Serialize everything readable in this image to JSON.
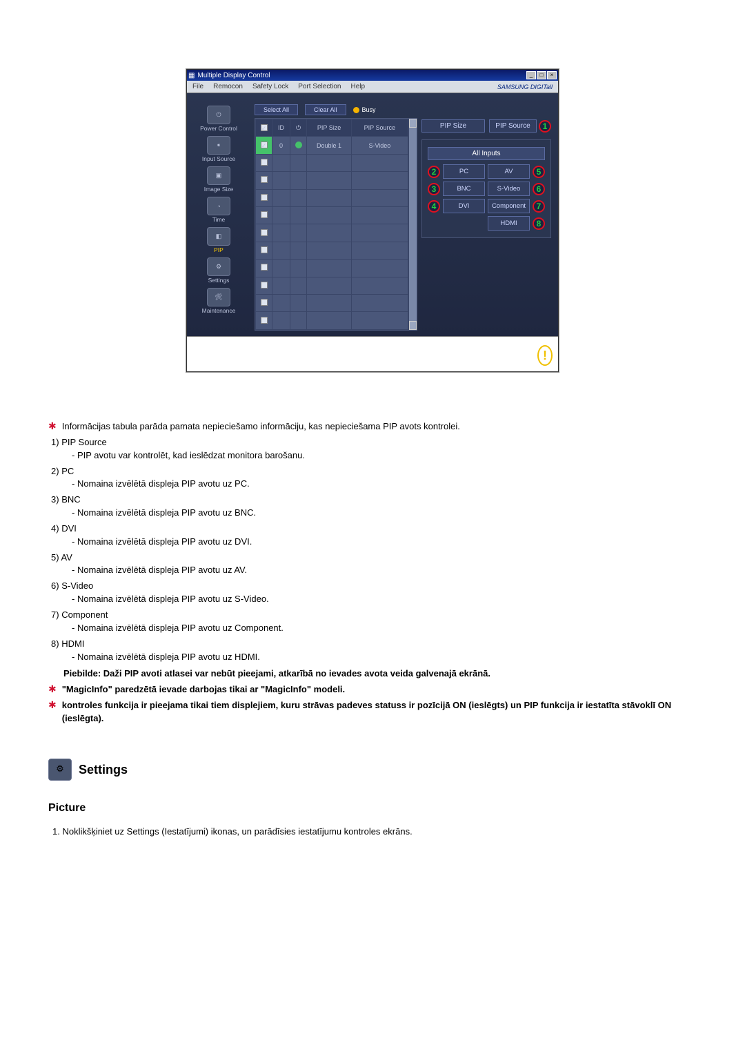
{
  "app": {
    "title": "Multiple Display Control",
    "menu": [
      "File",
      "Remocon",
      "Safety Lock",
      "Port Selection",
      "Help"
    ],
    "brand": "SAMSUNG DIGITall"
  },
  "sidebar": {
    "items": [
      {
        "label": "Power Control",
        "icon": "power-icon"
      },
      {
        "label": "Input Source",
        "icon": "input-icon"
      },
      {
        "label": "Image Size",
        "icon": "imagesize-icon"
      },
      {
        "label": "Time",
        "icon": "time-icon"
      },
      {
        "label": "PIP",
        "icon": "pip-icon",
        "selected": true
      },
      {
        "label": "Settings",
        "icon": "settings-icon"
      },
      {
        "label": "Maintenance",
        "icon": "maintenance-icon"
      }
    ]
  },
  "toolbar": {
    "select_all": "Select All",
    "clear_all": "Clear All",
    "busy": "Busy"
  },
  "grid": {
    "headers": {
      "chk": "",
      "id": "ID",
      "pwr": "",
      "pip_size": "PIP Size",
      "pip_source": "PIP Source"
    },
    "rows": [
      {
        "chk": true,
        "id": "0",
        "pwr": true,
        "pip_size": "Double 1",
        "pip_source": "S-Video"
      },
      {
        "chk": false
      },
      {
        "chk": false
      },
      {
        "chk": false
      },
      {
        "chk": false
      },
      {
        "chk": false
      },
      {
        "chk": false
      },
      {
        "chk": false
      },
      {
        "chk": false
      },
      {
        "chk": false
      },
      {
        "chk": false
      }
    ]
  },
  "panel": {
    "top_row": {
      "size_label": "PIP Size",
      "source_label": "PIP Source"
    },
    "all_inputs": "All Inputs",
    "buttons": {
      "pc": "PC",
      "bnc": "BNC",
      "dvi": "DVI",
      "av": "AV",
      "svideo": "S-Video",
      "component": "Component",
      "hdmi": "HDMI"
    },
    "callouts": {
      "source": "1",
      "pc": "2",
      "bnc": "3",
      "dvi": "4",
      "av": "5",
      "svideo": "6",
      "component": "7",
      "hdmi": "8"
    }
  },
  "docs": {
    "intro": "Informācijas tabula parāda pamata nepieciešamo informāciju, kas nepieciešama PIP avots kontrolei.",
    "items": [
      {
        "num": "1)",
        "title": "PIP Source",
        "desc": "- PIP avotu var kontrolēt, kad ieslēdzat monitora barošanu."
      },
      {
        "num": "2)",
        "title": "PC",
        "desc": "- Nomaina izvēlētā displeja PIP avotu uz PC."
      },
      {
        "num": "3)",
        "title": "BNC",
        "desc": "- Nomaina izvēlētā displeja PIP avotu uz BNC."
      },
      {
        "num": "4)",
        "title": "DVI",
        "desc": "- Nomaina izvēlētā displeja PIP avotu uz DVI."
      },
      {
        "num": "5)",
        "title": "AV",
        "desc": "- Nomaina izvēlētā displeja PIP avotu uz AV."
      },
      {
        "num": "6)",
        "title": "S-Video",
        "desc": "- Nomaina izvēlētā displeja PIP avotu uz S-Video."
      },
      {
        "num": "7)",
        "title": "Component",
        "desc": "- Nomaina izvēlētā displeja PIP avotu uz Component."
      },
      {
        "num": "8)",
        "title": "HDMI",
        "desc": "- Nomaina izvēlētā displeja PIP avotu uz HDMI."
      }
    ],
    "note": "Piebilde: Daži PIP avoti atlasei var nebūt pieejami, atkarībā no ievades avota veida galvenajā ekrānā.",
    "star2": "\"MagicInfo\" paredzētā ievade darbojas tikai ar \"MagicInfo\" modeli.",
    "star3": "kontroles funkcija ir pieejama tikai tiem displejiem, kuru strāvas padeves statuss ir pozīcijā ON (ieslēgts) un PIP funkcija ir iestatīta stāvoklī ON (ieslēgta).",
    "settings_heading": "Settings",
    "picture_heading": "Picture",
    "picture_item": "1.  Noklikšķiniet uz Settings (Iestatījumi) ikonas, un parādīsies iestatījumu kontroles ekrāns."
  }
}
